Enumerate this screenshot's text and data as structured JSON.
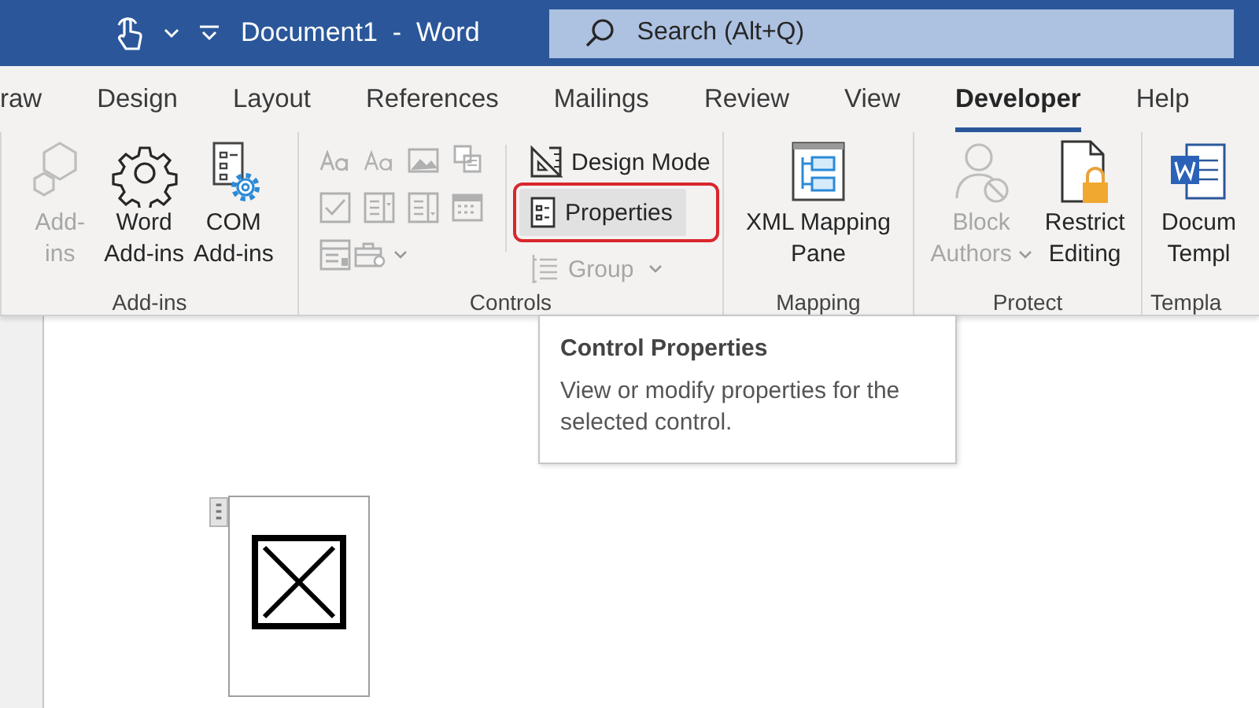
{
  "title_bar": {
    "title": "Document1  -  Word",
    "search": {
      "placeholder": "Search (Alt+Q)"
    }
  },
  "tabs": [
    {
      "label": "raw",
      "selected": false
    },
    {
      "label": "Design",
      "selected": false
    },
    {
      "label": "Layout",
      "selected": false
    },
    {
      "label": "References",
      "selected": false
    },
    {
      "label": "Mailings",
      "selected": false
    },
    {
      "label": "Review",
      "selected": false
    },
    {
      "label": "View",
      "selected": false
    },
    {
      "label": "Developer",
      "selected": true
    },
    {
      "label": "Help",
      "selected": false
    }
  ],
  "ribbon_groups": [
    {
      "kind": "large",
      "label": "Add-ins",
      "buttons": [
        {
          "lines": [
            "Add-",
            "ins"
          ],
          "disabled": true,
          "dropdown": false
        },
        {
          "lines": [
            "Word",
            "Add-ins"
          ],
          "disabled": false,
          "dropdown": false
        },
        {
          "lines": [
            "COM",
            "Add-ins"
          ],
          "disabled": false,
          "dropdown": false
        }
      ]
    },
    {
      "kind": "controls",
      "label": "Controls",
      "buttons": [
        {
          "label": "Design Mode",
          "disabled": false,
          "hover": false,
          "highlight_frame": false,
          "dropdown": false
        },
        {
          "label": "Properties",
          "disabled": false,
          "hover": true,
          "highlight_frame": true,
          "dropdown": false
        },
        {
          "label": "Group",
          "disabled": true,
          "hover": false,
          "highlight_frame": false,
          "dropdown": true
        }
      ]
    },
    {
      "kind": "large",
      "label": "Mapping",
      "buttons": [
        {
          "lines": [
            "XML Mapping",
            "Pane"
          ],
          "disabled": false,
          "dropdown": false
        }
      ]
    },
    {
      "kind": "large",
      "label": "Protect",
      "buttons": [
        {
          "lines": [
            "Block",
            "Authors"
          ],
          "disabled": true,
          "dropdown": true
        },
        {
          "lines": [
            "Restrict",
            "Editing"
          ],
          "disabled": false,
          "dropdown": false
        }
      ]
    },
    {
      "kind": "large",
      "label": "Templa",
      "buttons": [
        {
          "lines": [
            "Docum",
            "Templ"
          ],
          "disabled": false,
          "dropdown": false
        }
      ]
    }
  ],
  "tooltip": {
    "title": "Control Properties",
    "body": "View or modify properties for the selected control."
  }
}
